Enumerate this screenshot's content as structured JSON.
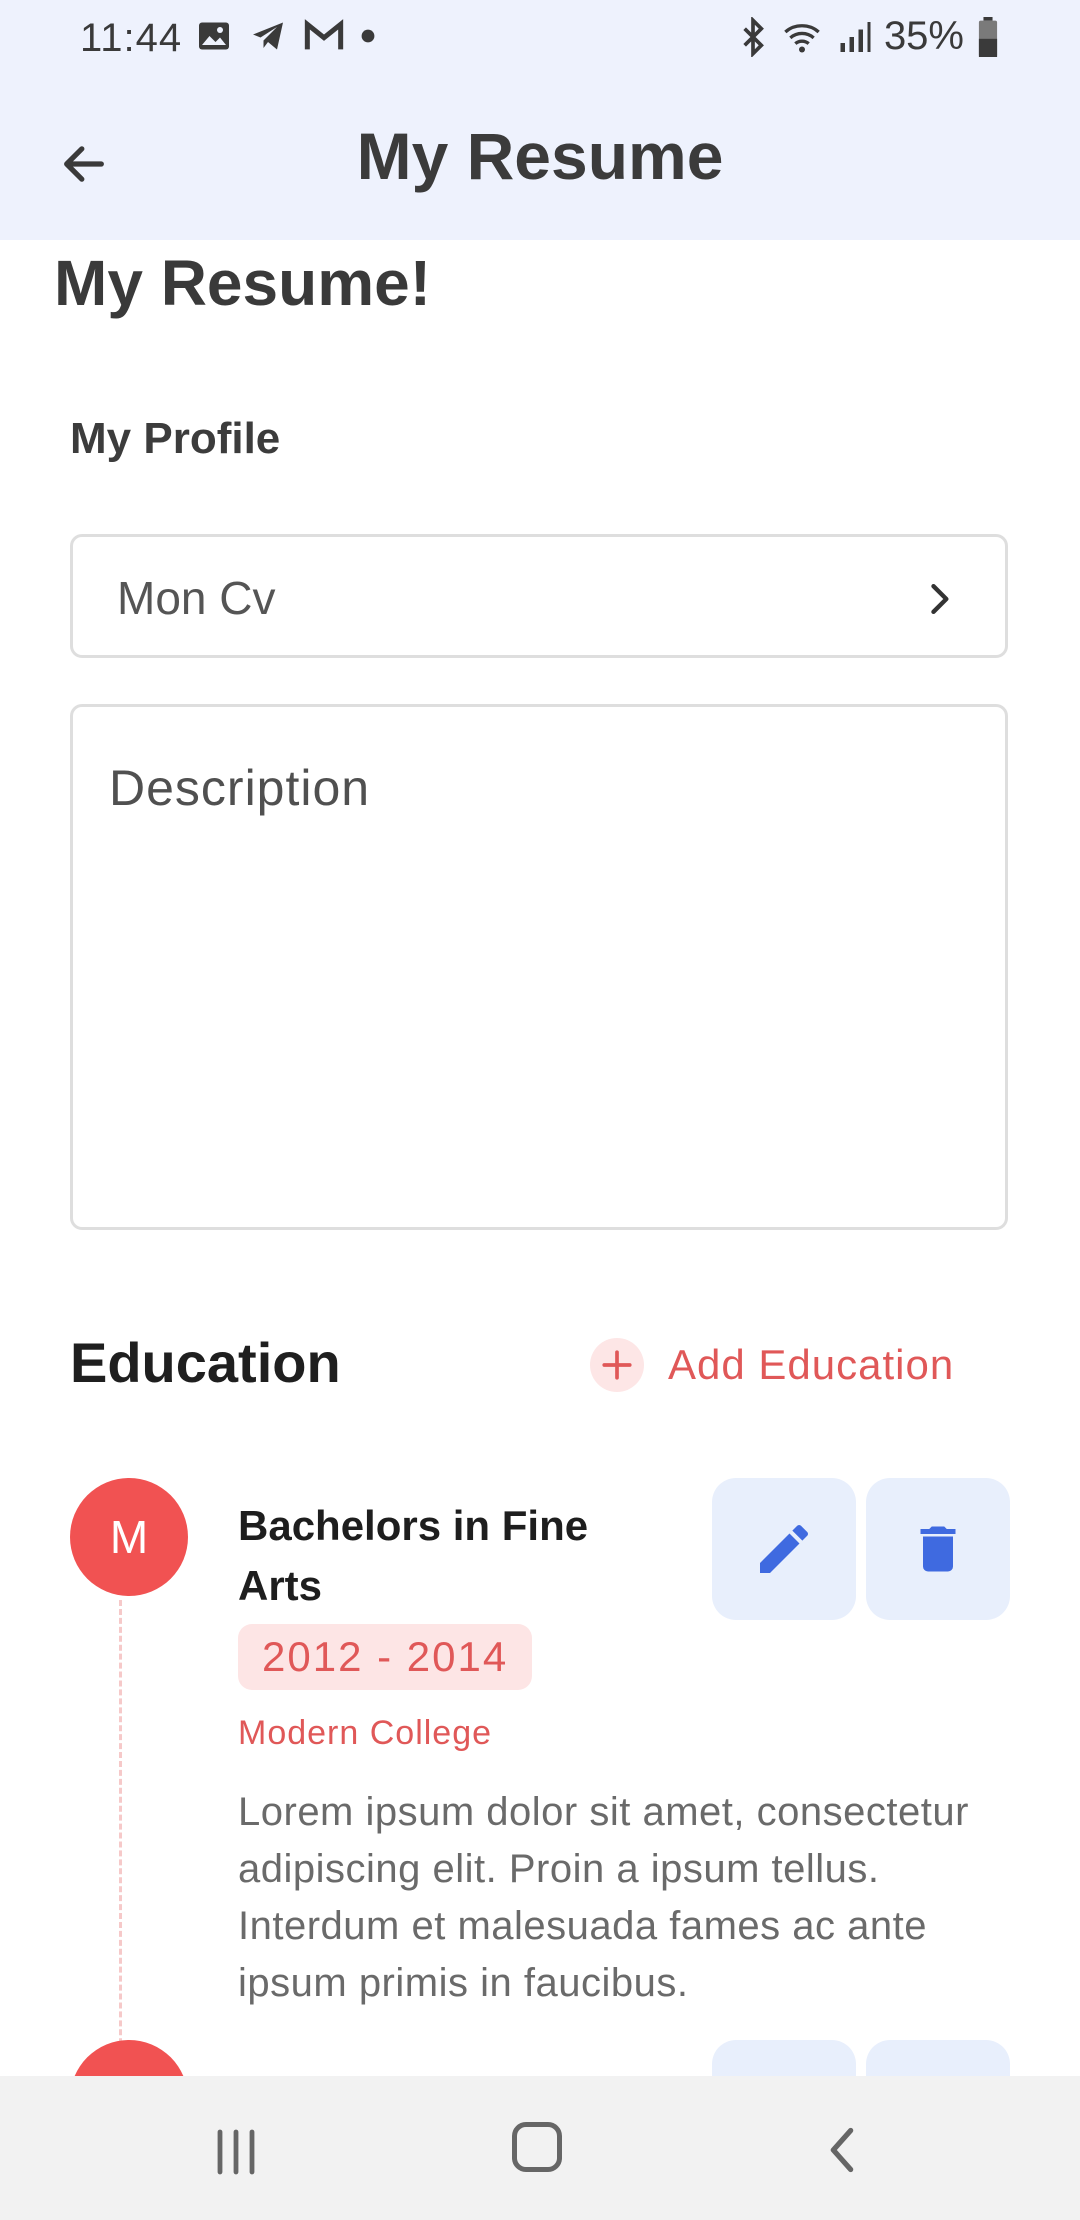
{
  "status_bar": {
    "time": "11:44",
    "battery": "35%",
    "icons": [
      "image-icon",
      "telegram-icon",
      "gmail-icon",
      "dot-icon",
      "bluetooth-icon",
      "wifi-icon",
      "signal-icon",
      "battery-icon"
    ]
  },
  "app_bar": {
    "title": "My Resume",
    "back_icon": "arrow-left-icon"
  },
  "page": {
    "heading": "My Resume!",
    "profile_label": "My Profile",
    "profile_value": "Mon Cv",
    "description_placeholder": "Description"
  },
  "education": {
    "heading": "Education",
    "add_label": "Add Education",
    "items": [
      {
        "avatar_letter": "M",
        "title": "Bachelors in Fine Arts",
        "years": "2012 - 2014",
        "school": "Modern College",
        "description": "Lorem ipsum dolor sit amet, consectetur adipiscing elit. Proin a ipsum tellus. Interdum et malesuada fames ac ante ipsum primis in faucibus."
      }
    ]
  },
  "colors": {
    "accent": "#f15252",
    "accent_soft": "#fde5e5",
    "button_bg": "#e8effc",
    "button_icon": "#3f6ae0",
    "app_bar_bg": "#eef2fd"
  }
}
